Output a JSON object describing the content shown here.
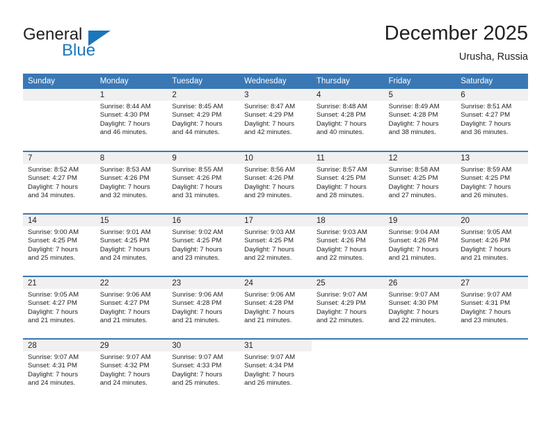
{
  "brand": {
    "name_part1": "General",
    "name_part2": "Blue",
    "accent_color": "#1c76bc"
  },
  "header": {
    "title": "December 2025",
    "subtitle": "Urusha, Russia"
  },
  "theme": {
    "header_row_color": "#3a78b5",
    "daynum_band_color": "#f0f0f0",
    "text_color": "#231f20"
  },
  "weekday_headers": [
    "Sunday",
    "Monday",
    "Tuesday",
    "Wednesday",
    "Thursday",
    "Friday",
    "Saturday"
  ],
  "weeks": [
    [
      {
        "day": "",
        "lines": []
      },
      {
        "day": "1",
        "lines": [
          "Sunrise: 8:44 AM",
          "Sunset: 4:30 PM",
          "Daylight: 7 hours",
          "and 46 minutes."
        ]
      },
      {
        "day": "2",
        "lines": [
          "Sunrise: 8:45 AM",
          "Sunset: 4:29 PM",
          "Daylight: 7 hours",
          "and 44 minutes."
        ]
      },
      {
        "day": "3",
        "lines": [
          "Sunrise: 8:47 AM",
          "Sunset: 4:29 PM",
          "Daylight: 7 hours",
          "and 42 minutes."
        ]
      },
      {
        "day": "4",
        "lines": [
          "Sunrise: 8:48 AM",
          "Sunset: 4:28 PM",
          "Daylight: 7 hours",
          "and 40 minutes."
        ]
      },
      {
        "day": "5",
        "lines": [
          "Sunrise: 8:49 AM",
          "Sunset: 4:28 PM",
          "Daylight: 7 hours",
          "and 38 minutes."
        ]
      },
      {
        "day": "6",
        "lines": [
          "Sunrise: 8:51 AM",
          "Sunset: 4:27 PM",
          "Daylight: 7 hours",
          "and 36 minutes."
        ]
      }
    ],
    [
      {
        "day": "7",
        "lines": [
          "Sunrise: 8:52 AM",
          "Sunset: 4:27 PM",
          "Daylight: 7 hours",
          "and 34 minutes."
        ]
      },
      {
        "day": "8",
        "lines": [
          "Sunrise: 8:53 AM",
          "Sunset: 4:26 PM",
          "Daylight: 7 hours",
          "and 32 minutes."
        ]
      },
      {
        "day": "9",
        "lines": [
          "Sunrise: 8:55 AM",
          "Sunset: 4:26 PM",
          "Daylight: 7 hours",
          "and 31 minutes."
        ]
      },
      {
        "day": "10",
        "lines": [
          "Sunrise: 8:56 AM",
          "Sunset: 4:26 PM",
          "Daylight: 7 hours",
          "and 29 minutes."
        ]
      },
      {
        "day": "11",
        "lines": [
          "Sunrise: 8:57 AM",
          "Sunset: 4:25 PM",
          "Daylight: 7 hours",
          "and 28 minutes."
        ]
      },
      {
        "day": "12",
        "lines": [
          "Sunrise: 8:58 AM",
          "Sunset: 4:25 PM",
          "Daylight: 7 hours",
          "and 27 minutes."
        ]
      },
      {
        "day": "13",
        "lines": [
          "Sunrise: 8:59 AM",
          "Sunset: 4:25 PM",
          "Daylight: 7 hours",
          "and 26 minutes."
        ]
      }
    ],
    [
      {
        "day": "14",
        "lines": [
          "Sunrise: 9:00 AM",
          "Sunset: 4:25 PM",
          "Daylight: 7 hours",
          "and 25 minutes."
        ]
      },
      {
        "day": "15",
        "lines": [
          "Sunrise: 9:01 AM",
          "Sunset: 4:25 PM",
          "Daylight: 7 hours",
          "and 24 minutes."
        ]
      },
      {
        "day": "16",
        "lines": [
          "Sunrise: 9:02 AM",
          "Sunset: 4:25 PM",
          "Daylight: 7 hours",
          "and 23 minutes."
        ]
      },
      {
        "day": "17",
        "lines": [
          "Sunrise: 9:03 AM",
          "Sunset: 4:25 PM",
          "Daylight: 7 hours",
          "and 22 minutes."
        ]
      },
      {
        "day": "18",
        "lines": [
          "Sunrise: 9:03 AM",
          "Sunset: 4:26 PM",
          "Daylight: 7 hours",
          "and 22 minutes."
        ]
      },
      {
        "day": "19",
        "lines": [
          "Sunrise: 9:04 AM",
          "Sunset: 4:26 PM",
          "Daylight: 7 hours",
          "and 21 minutes."
        ]
      },
      {
        "day": "20",
        "lines": [
          "Sunrise: 9:05 AM",
          "Sunset: 4:26 PM",
          "Daylight: 7 hours",
          "and 21 minutes."
        ]
      }
    ],
    [
      {
        "day": "21",
        "lines": [
          "Sunrise: 9:05 AM",
          "Sunset: 4:27 PM",
          "Daylight: 7 hours",
          "and 21 minutes."
        ]
      },
      {
        "day": "22",
        "lines": [
          "Sunrise: 9:06 AM",
          "Sunset: 4:27 PM",
          "Daylight: 7 hours",
          "and 21 minutes."
        ]
      },
      {
        "day": "23",
        "lines": [
          "Sunrise: 9:06 AM",
          "Sunset: 4:28 PM",
          "Daylight: 7 hours",
          "and 21 minutes."
        ]
      },
      {
        "day": "24",
        "lines": [
          "Sunrise: 9:06 AM",
          "Sunset: 4:28 PM",
          "Daylight: 7 hours",
          "and 21 minutes."
        ]
      },
      {
        "day": "25",
        "lines": [
          "Sunrise: 9:07 AM",
          "Sunset: 4:29 PM",
          "Daylight: 7 hours",
          "and 22 minutes."
        ]
      },
      {
        "day": "26",
        "lines": [
          "Sunrise: 9:07 AM",
          "Sunset: 4:30 PM",
          "Daylight: 7 hours",
          "and 22 minutes."
        ]
      },
      {
        "day": "27",
        "lines": [
          "Sunrise: 9:07 AM",
          "Sunset: 4:31 PM",
          "Daylight: 7 hours",
          "and 23 minutes."
        ]
      }
    ],
    [
      {
        "day": "28",
        "lines": [
          "Sunrise: 9:07 AM",
          "Sunset: 4:31 PM",
          "Daylight: 7 hours",
          "and 24 minutes."
        ]
      },
      {
        "day": "29",
        "lines": [
          "Sunrise: 9:07 AM",
          "Sunset: 4:32 PM",
          "Daylight: 7 hours",
          "and 24 minutes."
        ]
      },
      {
        "day": "30",
        "lines": [
          "Sunrise: 9:07 AM",
          "Sunset: 4:33 PM",
          "Daylight: 7 hours",
          "and 25 minutes."
        ]
      },
      {
        "day": "31",
        "lines": [
          "Sunrise: 9:07 AM",
          "Sunset: 4:34 PM",
          "Daylight: 7 hours",
          "and 26 minutes."
        ]
      },
      {
        "day": "",
        "lines": []
      },
      {
        "day": "",
        "lines": []
      },
      {
        "day": "",
        "lines": []
      }
    ]
  ]
}
